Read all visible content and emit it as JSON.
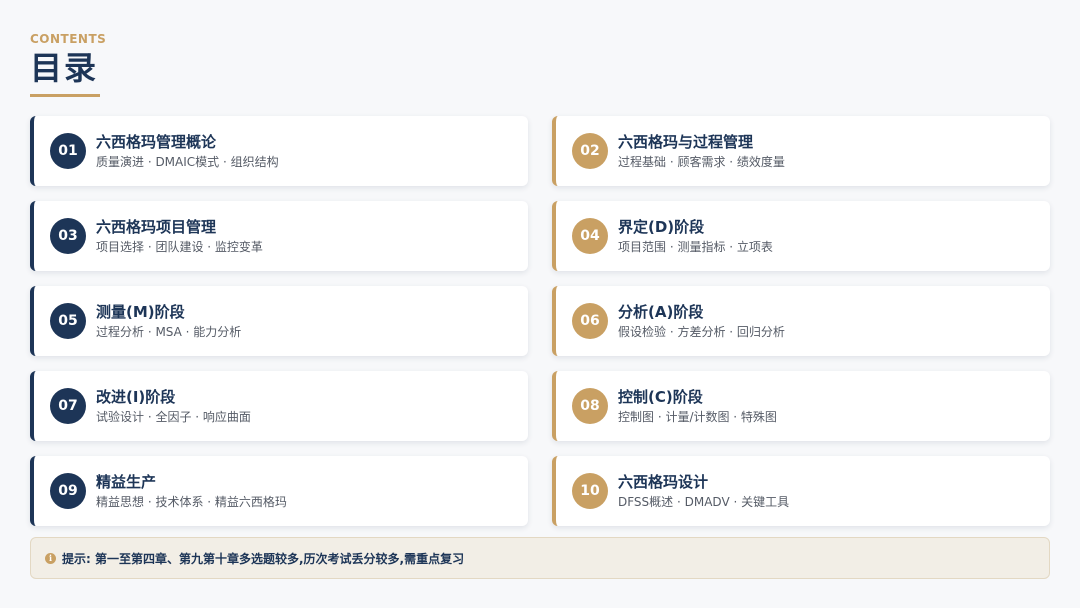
{
  "header": {
    "subtitle": "CONTENTS",
    "title": "目录"
  },
  "colors": {
    "navy": "#1d3557",
    "gold": "#c9a063",
    "tip_bg": "#f2eee6"
  },
  "sections": [
    {
      "num": "01",
      "title": "六西格玛管理概论",
      "desc": "质量演进 · DMAIC模式 · 组织结构",
      "accent": "navy"
    },
    {
      "num": "02",
      "title": "六西格玛与过程管理",
      "desc": "过程基础 · 顾客需求 · 绩效度量",
      "accent": "gold"
    },
    {
      "num": "03",
      "title": "六西格玛项目管理",
      "desc": "项目选择 · 团队建设 · 监控变革",
      "accent": "navy"
    },
    {
      "num": "04",
      "title": "界定(D)阶段",
      "desc": "项目范围 · 测量指标 · 立项表",
      "accent": "gold"
    },
    {
      "num": "05",
      "title": "测量(M)阶段",
      "desc": "过程分析 · MSA · 能力分析",
      "accent": "navy"
    },
    {
      "num": "06",
      "title": "分析(A)阶段",
      "desc": "假设检验 · 方差分析 · 回归分析",
      "accent": "gold"
    },
    {
      "num": "07",
      "title": "改进(I)阶段",
      "desc": "试验设计 · 全因子 · 响应曲面",
      "accent": "navy"
    },
    {
      "num": "08",
      "title": "控制(C)阶段",
      "desc": "控制图 · 计量/计数图 · 特殊图",
      "accent": "gold"
    },
    {
      "num": "09",
      "title": "精益生产",
      "desc": "精益思想 · 技术体系 · 精益六西格玛",
      "accent": "navy"
    },
    {
      "num": "10",
      "title": "六西格玛设计",
      "desc": "DFSS概述 · DMADV · 关键工具",
      "accent": "gold"
    }
  ],
  "tip": {
    "icon": "info-icon",
    "icon_glyph": "i",
    "text": "提示: 第一至第四章、第九第十章多选题较多,历次考试丢分较多,需重点复习"
  }
}
